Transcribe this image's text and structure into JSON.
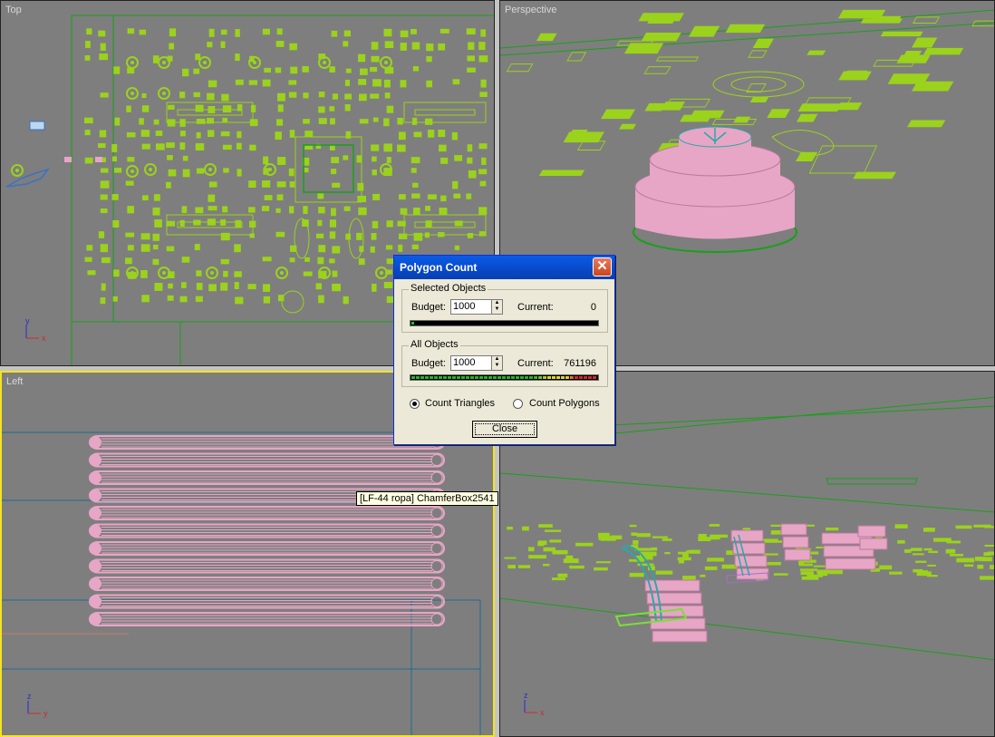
{
  "viewports": {
    "top": {
      "label": "Top"
    },
    "perspective": {
      "label": "Perspective"
    },
    "left": {
      "label": "Left"
    },
    "camera": {
      "label": ""
    }
  },
  "tooltip": {
    "text": "[LF-44 ropa] ChamferBox2541"
  },
  "axis_labels": {
    "x": "x",
    "y": "y",
    "z": "z"
  },
  "dialog": {
    "title": "Polygon Count",
    "close_icon": "close-icon",
    "selected": {
      "group_title": "Selected Objects",
      "budget_label": "Budget:",
      "budget_value": "1000",
      "current_label": "Current:",
      "current_value": "0",
      "bar_fraction": 0.0
    },
    "all": {
      "group_title": "All Objects",
      "budget_label": "Budget:",
      "budget_value": "1000",
      "current_label": "Current:",
      "current_value": "761196",
      "bar_fraction": 1.0
    },
    "count_triangles_label": "Count Triangles",
    "count_polygons_label": "Count Polygons",
    "count_mode": "triangles",
    "close_label": "Close"
  },
  "colors": {
    "viewport_bg": "#7e7e7e",
    "wire_green": "#9bd21c",
    "wire_dark_green": "#18a018",
    "selection_pink": "#e7a6c6",
    "active_border": "#f4e41c"
  }
}
